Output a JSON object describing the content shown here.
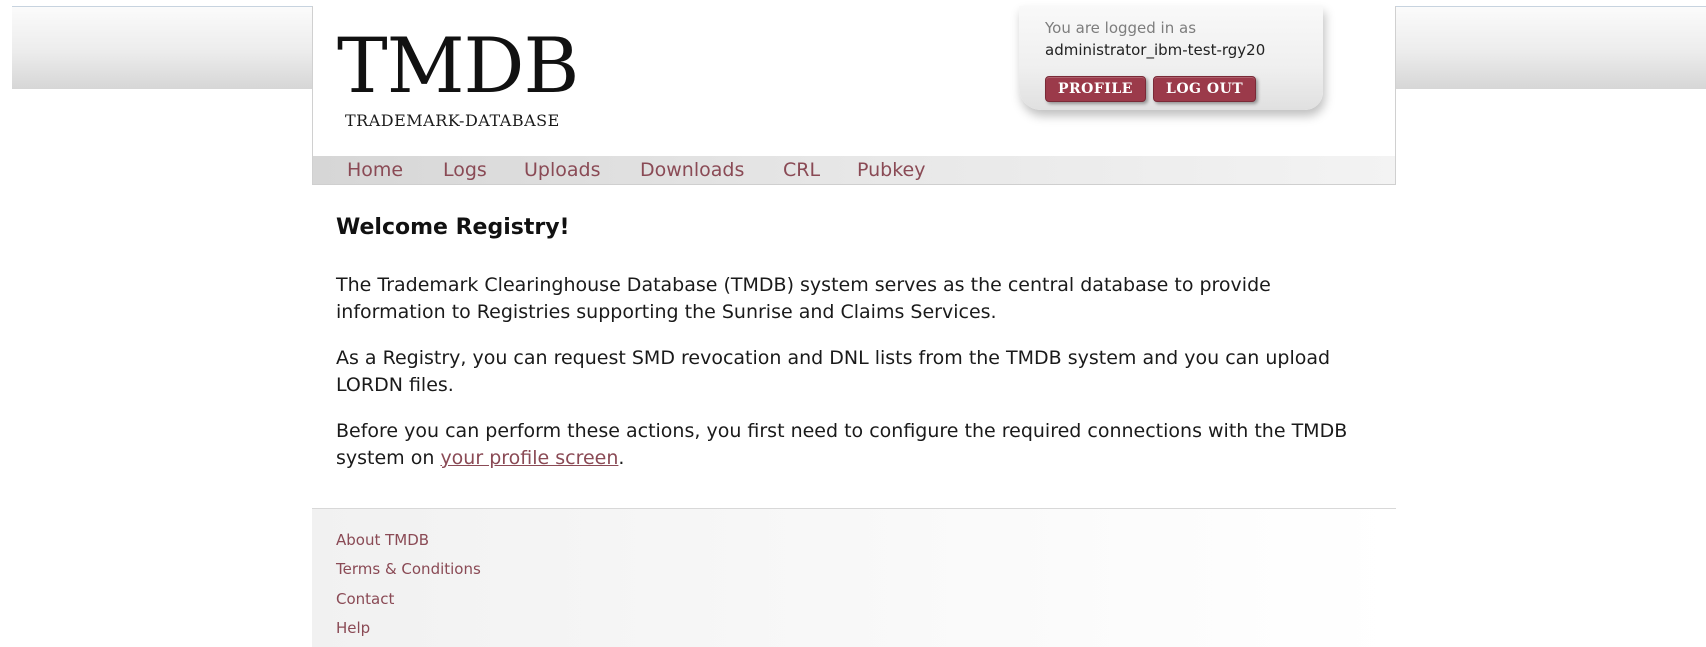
{
  "logo": {
    "title": "TMDB",
    "subtitle": "TRADEMARK-DATABASE"
  },
  "user": {
    "logged_in_label": "You are logged in as",
    "username": "administrator_ibm-test-rgy20",
    "profile_button": "PROFILE",
    "logout_button": "LOG OUT"
  },
  "nav": {
    "items": [
      "Home",
      "Logs",
      "Uploads",
      "Downloads",
      "CRL",
      "Pubkey"
    ]
  },
  "main": {
    "heading": "Welcome Registry!",
    "paragraph1": "The Trademark Clearinghouse Database (TMDB) system serves as the central database to provide information to Registries supporting the Sunrise and Claims Services.",
    "paragraph2": "As a Registry, you can request SMD revocation and DNL lists from the TMDB system and you can upload LORDN files.",
    "paragraph3_before": "Before you can perform these actions, you first need to configure the required connections with the TMDB system on ",
    "paragraph3_link": "your profile screen",
    "paragraph3_after": "."
  },
  "footer": {
    "links": [
      "About TMDB",
      "Terms & Conditions",
      "Contact",
      "Help"
    ]
  },
  "colors": {
    "accent": "#9b3a4a",
    "link": "#8a4a55"
  }
}
